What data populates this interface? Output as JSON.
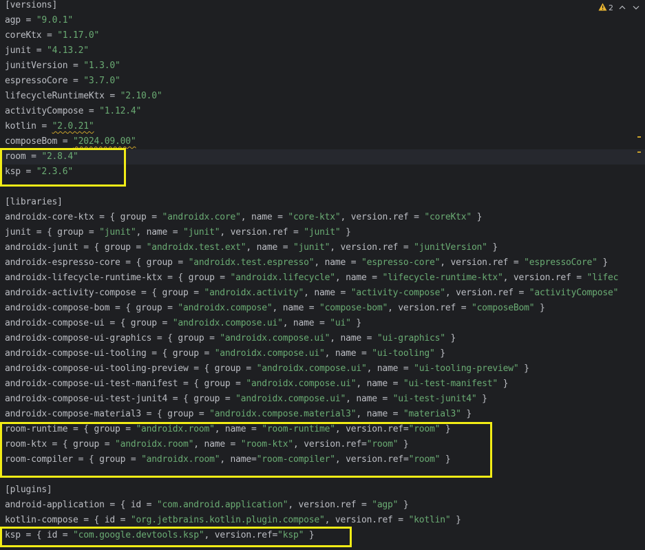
{
  "versions": {
    "header": "[versions]",
    "entries": [
      {
        "key": "agp",
        "value": "\"9.0.1\""
      },
      {
        "key": "coreKtx",
        "value": "\"1.17.0\""
      },
      {
        "key": "junit",
        "value": "\"4.13.2\""
      },
      {
        "key": "junitVersion",
        "value": "\"1.3.0\""
      },
      {
        "key": "espressoCore",
        "value": "\"3.7.0\""
      },
      {
        "key": "lifecycleRuntimeKtx",
        "value": "\"2.10.0\""
      },
      {
        "key": "activityCompose",
        "value": "\"1.12.4\""
      },
      {
        "key": "kotlin",
        "value": "\"2.0.21\""
      },
      {
        "key": "composeBom",
        "value": "\"2024.09.00\""
      },
      {
        "key": "room",
        "value": "\"2.8.4\""
      },
      {
        "key": "ksp",
        "value": "\"2.3.6\""
      }
    ]
  },
  "libraries": {
    "header": "[libraries]",
    "entries": [
      {
        "key": "androidx-core-ktx",
        "rest": "{ group = \"androidx.core\", name = \"core-ktx\", version.ref = \"coreKtx\" }"
      },
      {
        "key": "junit",
        "rest": "{ group = \"junit\", name = \"junit\", version.ref = \"junit\" }"
      },
      {
        "key": "androidx-junit",
        "rest": "{ group = \"androidx.test.ext\", name = \"junit\", version.ref = \"junitVersion\" }"
      },
      {
        "key": "androidx-espresso-core",
        "rest": "{ group = \"androidx.test.espresso\", name = \"espresso-core\", version.ref = \"espressoCore\" }"
      },
      {
        "key": "androidx-lifecycle-runtime-ktx",
        "rest": "{ group = \"androidx.lifecycle\", name = \"lifecycle-runtime-ktx\", version.ref = \"lifec"
      },
      {
        "key": "androidx-activity-compose",
        "rest": "{ group = \"androidx.activity\", name = \"activity-compose\", version.ref = \"activityCompose\""
      },
      {
        "key": "androidx-compose-bom",
        "rest": "{ group = \"androidx.compose\", name = \"compose-bom\", version.ref = \"composeBom\" }"
      },
      {
        "key": "androidx-compose-ui",
        "rest": "{ group = \"androidx.compose.ui\", name = \"ui\" }"
      },
      {
        "key": "androidx-compose-ui-graphics",
        "rest": "{ group = \"androidx.compose.ui\", name = \"ui-graphics\" }"
      },
      {
        "key": "androidx-compose-ui-tooling",
        "rest": "{ group = \"androidx.compose.ui\", name = \"ui-tooling\" }"
      },
      {
        "key": "androidx-compose-ui-tooling-preview",
        "rest": "{ group = \"androidx.compose.ui\", name = \"ui-tooling-preview\" }"
      },
      {
        "key": "androidx-compose-ui-test-manifest",
        "rest": "{ group = \"androidx.compose.ui\", name = \"ui-test-manifest\" }"
      },
      {
        "key": "androidx-compose-ui-test-junit4",
        "rest": "{ group = \"androidx.compose.ui\", name = \"ui-test-junit4\" }"
      },
      {
        "key": "androidx-compose-material3",
        "rest": "{ group = \"androidx.compose.material3\", name = \"material3\" }"
      },
      {
        "key": "room-runtime",
        "rest": "{ group = \"androidx.room\", name = \"room-runtime\", version.ref=\"room\" }"
      },
      {
        "key": "room-ktx",
        "rest": "{ group = \"androidx.room\", name = \"room-ktx\", version.ref=\"room\" }"
      },
      {
        "key": "room-compiler",
        "rest": "{ group = \"androidx.room\", name=\"room-compiler\", version.ref=\"room\" }"
      }
    ]
  },
  "plugins": {
    "header": "[plugins]",
    "entries": [
      {
        "key": "android-application",
        "rest": "{ id = \"com.android.application\", version.ref = \"agp\" }"
      },
      {
        "key": "kotlin-compose",
        "rest": "{ id = \"org.jetbrains.kotlin.plugin.compose\", version.ref = \"kotlin\" }"
      },
      {
        "key": "ksp",
        "rest": "{ id = \"com.google.devtools.ksp\", version.ref=\"ksp\" }"
      }
    ]
  },
  "inspection_widget": {
    "warning_count": "2",
    "warning_icon": "warning-triangle-icon",
    "up_icon": "chevron-up-icon",
    "down_icon": "chevron-down-icon"
  },
  "colors": {
    "background": "#1e1f22",
    "text": "#bcbec4",
    "string": "#6aab73",
    "highlight_box": "#f2ec16",
    "warning": "#c9a12b"
  }
}
